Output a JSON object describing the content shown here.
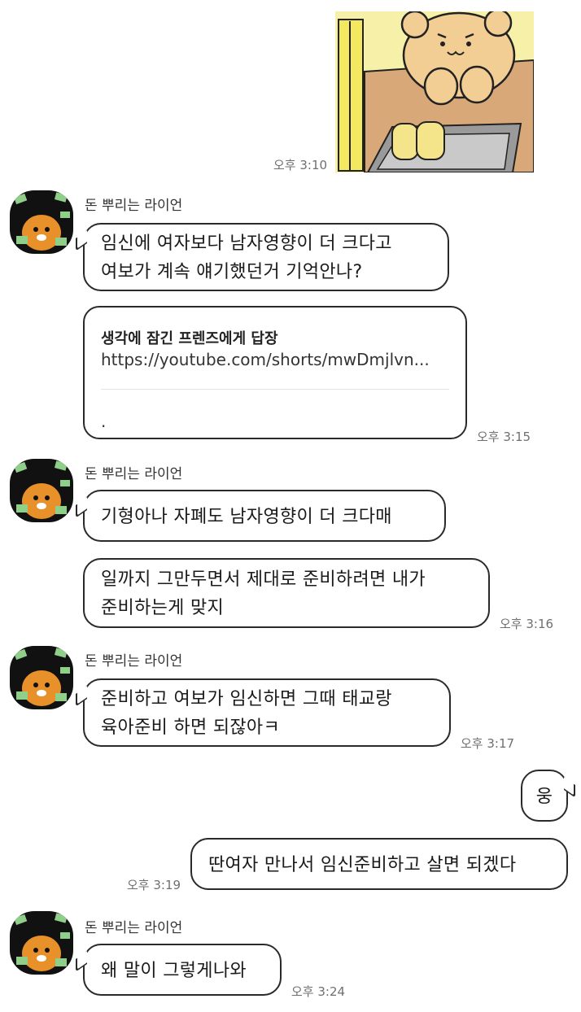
{
  "chat": {
    "sender_name": "돈 뿌리는 라이언",
    "messages": [
      {
        "id": "m1",
        "side": "right",
        "type": "sticker",
        "sticker": "bear-cashier-sticker",
        "time": "오후 3:10"
      },
      {
        "id": "m2",
        "side": "left",
        "type": "text",
        "lines": [
          "임신에 여자보다 남자영향이 더 크다고",
          "여보가 계속 얘기했던거 기억안나?"
        ]
      },
      {
        "id": "m3",
        "side": "left",
        "type": "link",
        "title": "생각에 잠긴 프렌즈에게 답장",
        "url": "https://youtube.com/shorts/mwDmjlvn...",
        "desc": ".",
        "time": "오후 3:15"
      },
      {
        "id": "m4",
        "side": "left",
        "type": "text",
        "lines": [
          "기형아나 자폐도 남자영향이 더 크다매"
        ]
      },
      {
        "id": "m5",
        "side": "left",
        "type": "text",
        "lines": [
          "일까지 그만두면서 제대로 준비하려면 내가",
          "준비하는게 맞지"
        ],
        "time": "오후 3:16"
      },
      {
        "id": "m6",
        "side": "left",
        "type": "text",
        "lines": [
          "준비하고 여보가 임신하면 그때 태교랑",
          "육아준비 하면 되잖아ㅋ"
        ],
        "time": "오후 3:17"
      },
      {
        "id": "m7",
        "side": "right",
        "type": "text",
        "lines": [
          "웅"
        ]
      },
      {
        "id": "m8",
        "side": "right",
        "type": "text",
        "lines": [
          "딴여자 만나서 임신준비하고 살면 되겠다"
        ],
        "time": "오후 3:19"
      },
      {
        "id": "m9",
        "side": "left",
        "type": "text",
        "lines": [
          "왜 말이 그렇게나와"
        ],
        "time": "오후 3:24"
      }
    ]
  },
  "colors": {
    "bubble_border": "#2a2a2a",
    "avatar_bg": "#111111",
    "lion_orange": "#e8902a",
    "bear_fur": "#f2cd94",
    "sticker_wall": "#f6f0a8",
    "counter": "#d8a878"
  }
}
